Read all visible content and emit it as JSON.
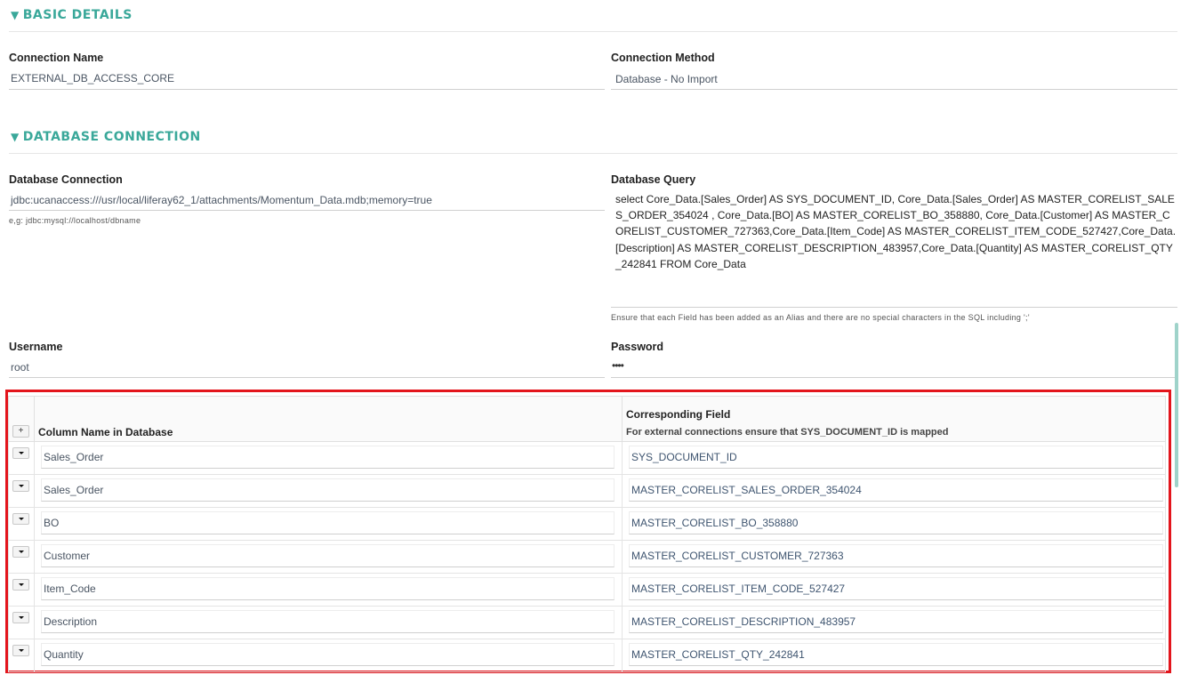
{
  "basic_details": {
    "title": "BASIC DETAILS",
    "connection_name_label": "Connection Name",
    "connection_name_value": "EXTERNAL_DB_ACCESS_CORE",
    "connection_method_label": "Connection Method",
    "connection_method_value": "Database - No Import"
  },
  "database_connection": {
    "title": "DATABASE CONNECTION",
    "connection_label": "Database Connection",
    "connection_value": "jdbc:ucanaccess:///usr/local/liferay62_1/attachments/Momentum_Data.mdb;memory=true",
    "connection_hint": "e,g: jdbc:mysql://localhost/dbname",
    "query_label": "Database Query",
    "query_value": "select Core_Data.[Sales_Order] AS SYS_DOCUMENT_ID, Core_Data.[Sales_Order] AS MASTER_CORELIST_SALES_ORDER_354024 , Core_Data.[BO] AS MASTER_CORELIST_BO_358880, Core_Data.[Customer] AS MASTER_CORELIST_CUSTOMER_727363,Core_Data.[Item_Code] AS MASTER_CORELIST_ITEM_CODE_527427,Core_Data.[Description] AS MASTER_CORELIST_DESCRIPTION_483957,Core_Data.[Quantity] AS MASTER_CORELIST_QTY_242841 FROM Core_Data",
    "query_hint": "Ensure that each Field has been added as an Alias and there are no special characters in the SQL including ';'",
    "username_label": "Username",
    "username_value": "root",
    "password_label": "Password",
    "password_value": "••••"
  },
  "mapping": {
    "add_button": "+",
    "col1_header": "Column Name in Database",
    "col2_header": "Corresponding Field",
    "col2_subheader": "For external connections ensure that SYS_DOCUMENT_ID is mapped",
    "rows": [
      {
        "column": "Sales_Order",
        "field": "SYS_DOCUMENT_ID"
      },
      {
        "column": "Sales_Order",
        "field": "MASTER_CORELIST_SALES_ORDER_354024"
      },
      {
        "column": "BO",
        "field": "MASTER_CORELIST_BO_358880"
      },
      {
        "column": "Customer",
        "field": "MASTER_CORELIST_CUSTOMER_727363"
      },
      {
        "column": "Item_Code",
        "field": "MASTER_CORELIST_ITEM_CODE_527427"
      },
      {
        "column": "Description",
        "field": "MASTER_CORELIST_DESCRIPTION_483957"
      },
      {
        "column": "Quantity",
        "field": "MASTER_CORELIST_QTY_242841"
      }
    ]
  },
  "colors": {
    "section_accent": "#3aa89a",
    "highlight_border": "#e3151c"
  }
}
